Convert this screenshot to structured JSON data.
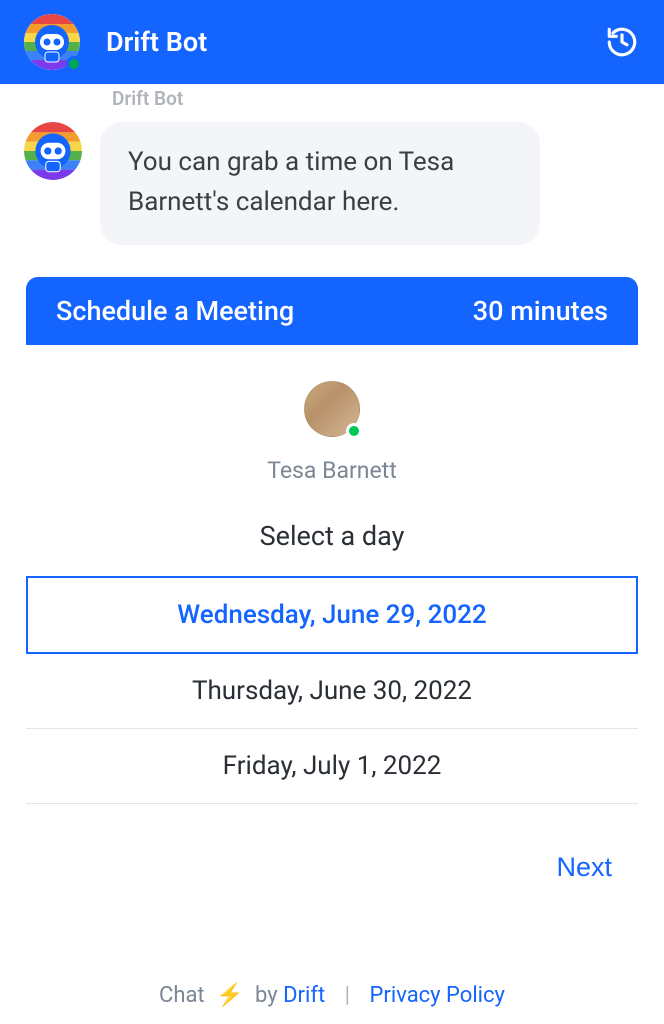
{
  "header": {
    "title": "Drift Bot",
    "bot_avatar": "drift-bot",
    "history_icon": "history"
  },
  "sender_label": "Drift Bot",
  "message": {
    "text": "You can grab a time on Tesa Barnett's calendar here."
  },
  "schedule_bar": {
    "title": "Schedule a Meeting",
    "duration": "30 minutes"
  },
  "host": {
    "name": "Tesa Barnett",
    "status": "online"
  },
  "select_day_title": "Select a day",
  "days": [
    {
      "label": "Wednesday, June 29, 2022",
      "selected": true
    },
    {
      "label": "Thursday, June 30, 2022",
      "selected": false
    },
    {
      "label": "Friday, July 1, 2022",
      "selected": false
    }
  ],
  "next_label": "Next",
  "footer": {
    "chat_prefix": "Chat",
    "by": "by",
    "brand": "Drift",
    "privacy": "Privacy Policy"
  },
  "colors": {
    "primary": "#1464ff",
    "bubble": "#f3f5f8",
    "muted": "#7b8794",
    "status_green": "#00c853"
  }
}
